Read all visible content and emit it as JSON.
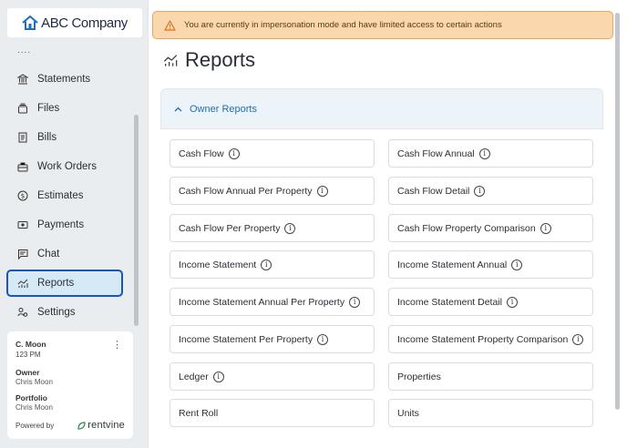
{
  "brand": {
    "logo_text": "ABC Company"
  },
  "sidebar": {
    "overflow_dots": "....",
    "items": [
      {
        "label": "Statements",
        "icon": "bank-icon"
      },
      {
        "label": "Files",
        "icon": "folder-stack-icon"
      },
      {
        "label": "Bills",
        "icon": "receipt-icon"
      },
      {
        "label": "Work Orders",
        "icon": "toolbox-icon"
      },
      {
        "label": "Estimates",
        "icon": "dollar-circle-icon"
      },
      {
        "label": "Payments",
        "icon": "money-icon"
      },
      {
        "label": "Chat",
        "icon": "chat-icon"
      },
      {
        "label": "Reports",
        "icon": "reports-chart-icon",
        "active": true
      },
      {
        "label": "Settings",
        "icon": "settings-people-icon"
      }
    ]
  },
  "user_card": {
    "name": "C. Moon",
    "id": "123 PM",
    "role_label": "Owner",
    "role_value": "Chris Moon",
    "portfolio_label": "Portfolio",
    "portfolio_value": "Chris Moon",
    "powered_by": "Powered by",
    "powered_brand": "rentvine"
  },
  "banner": {
    "message": "You are currently in impersonation mode and have limited access to certain actions",
    "icon": "warning-triangle-icon"
  },
  "page": {
    "title": "Reports",
    "title_icon": "reports-chart-icon"
  },
  "section": {
    "title": "Owner Reports",
    "expanded": true,
    "reports": [
      {
        "label": "Cash Flow",
        "info": true
      },
      {
        "label": "Cash Flow Annual",
        "info": true
      },
      {
        "label": "Cash Flow Annual Per Property",
        "info": true
      },
      {
        "label": "Cash Flow Detail",
        "info": true
      },
      {
        "label": "Cash Flow Per Property",
        "info": true
      },
      {
        "label": "Cash Flow Property Comparison",
        "info": true
      },
      {
        "label": "Income Statement",
        "info": true
      },
      {
        "label": "Income Statement Annual",
        "info": true
      },
      {
        "label": "Income Statement Annual Per Property",
        "info": true
      },
      {
        "label": "Income Statement Detail",
        "info": true
      },
      {
        "label": "Income Statement Per Property",
        "info": true
      },
      {
        "label": "Income Statement Property Comparison",
        "info": true
      },
      {
        "label": "Ledger",
        "info": true
      },
      {
        "label": "Properties",
        "info": false
      },
      {
        "label": "Rent Roll",
        "info": false
      },
      {
        "label": "Units",
        "info": false
      }
    ]
  },
  "colors": {
    "accent": "#1a56b8",
    "link": "#1f6fb5",
    "banner_bg": "#fbd7ad",
    "banner_border": "#e7a55e",
    "active_bg": "#d6e9f7"
  }
}
